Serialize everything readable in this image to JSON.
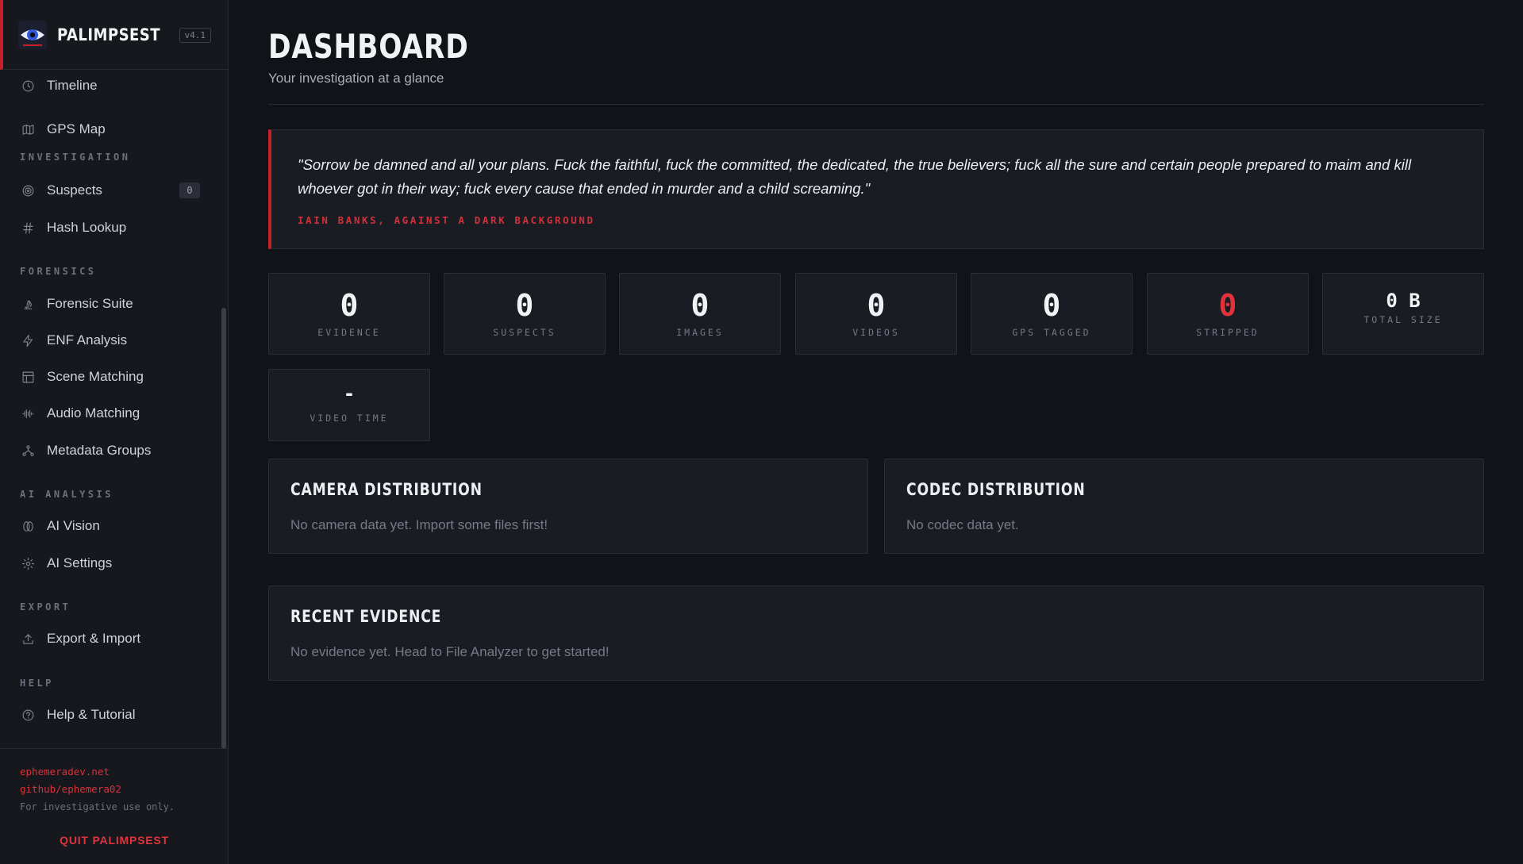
{
  "app": {
    "name": "PALIMPSEST",
    "version": "v4.1"
  },
  "sidebar": {
    "items_top": [
      {
        "label": "Timeline",
        "icon": "clock-icon"
      },
      {
        "label": "GPS Map",
        "icon": "map-icon"
      }
    ],
    "sections": [
      {
        "title": "INVESTIGATION",
        "items": [
          {
            "label": "Suspects",
            "icon": "target-icon",
            "badge": "0"
          },
          {
            "label": "Hash Lookup",
            "icon": "hash-icon"
          }
        ]
      },
      {
        "title": "FORENSICS",
        "items": [
          {
            "label": "Forensic Suite",
            "icon": "microscope-icon"
          },
          {
            "label": "ENF Analysis",
            "icon": "lightning-icon"
          },
          {
            "label": "Scene Matching",
            "icon": "layout-icon"
          },
          {
            "label": "Audio Matching",
            "icon": "audio-waveform-icon"
          },
          {
            "label": "Metadata Groups",
            "icon": "network-icon"
          }
        ]
      },
      {
        "title": "AI ANALYSIS",
        "items": [
          {
            "label": "AI Vision",
            "icon": "vision-icon"
          },
          {
            "label": "AI Settings",
            "icon": "gear-icon"
          }
        ]
      },
      {
        "title": "EXPORT",
        "items": [
          {
            "label": "Export & Import",
            "icon": "upload-icon"
          }
        ]
      },
      {
        "title": "HELP",
        "items": [
          {
            "label": "Help & Tutorial",
            "icon": "help-circle-icon"
          }
        ]
      }
    ],
    "footer": {
      "link1": "ephemeradev.net",
      "link2": "github/ephemera02",
      "note": "For investigative use only.",
      "quit_label": "QUIT PALIMPSEST"
    }
  },
  "main": {
    "title": "DASHBOARD",
    "subtitle": "Your investigation at a glance",
    "quote": {
      "text": "\"Sorrow be damned and all your plans. Fuck the faithful, fuck the committed, the dedicated, the true believers; fuck all the sure and certain people prepared to maim and kill whoever got in their way; fuck every cause that ended in murder and a child screaming.\"",
      "attribution": "IAIN BANKS, AGAINST A DARK BACKGROUND"
    },
    "stats": [
      {
        "value": "0",
        "label": "EVIDENCE"
      },
      {
        "value": "0",
        "label": "SUSPECTS"
      },
      {
        "value": "0",
        "label": "IMAGES"
      },
      {
        "value": "0",
        "label": "VIDEOS"
      },
      {
        "value": "0",
        "label": "GPS TAGGED"
      },
      {
        "value": "0",
        "label": "STRIPPED"
      },
      {
        "value": "0 B",
        "label": "TOTAL SIZE"
      },
      {
        "value": "-",
        "label": "VIDEO TIME"
      }
    ],
    "camera_panel": {
      "title": "CAMERA DISTRIBUTION",
      "empty": "No camera data yet. Import some files first!"
    },
    "codec_panel": {
      "title": "CODEC DISTRIBUTION",
      "empty": "No codec data yet."
    },
    "recent_panel": {
      "title": "RECENT EVIDENCE",
      "empty": "No evidence yet. Head to File Analyzer to get started!"
    }
  },
  "colors": {
    "accent": "#c8202a",
    "background": "#121318",
    "sidebar": "#16181e",
    "card": "#1a1c23"
  }
}
